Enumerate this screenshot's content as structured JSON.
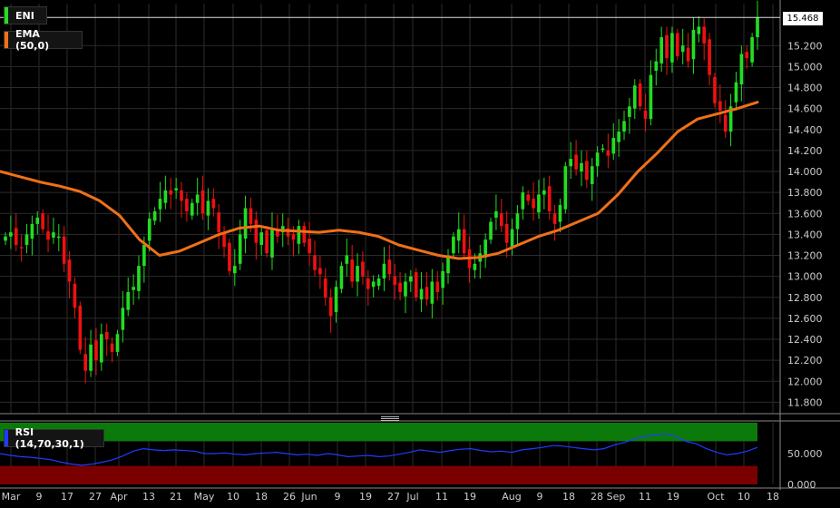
{
  "colors": {
    "background": "#000000",
    "grid": "#2b2b2b",
    "up": "#22dd22",
    "down": "#ee1111",
    "ema": "#f07018",
    "rsi_line": "#1e3cff",
    "rsi_overbought_zone": "#0b7a0b",
    "rsi_oversold_zone": "#7a0000",
    "axis_text": "#cccccc"
  },
  "legend": {
    "symbol": "ENI",
    "ema_label": "EMA (50,0)",
    "rsi_label": "RSI (14,70,30,1)"
  },
  "last_price_label": "15.468",
  "chart_data": [
    {
      "type": "candlestick",
      "title": "ENI",
      "x_tick_labels": [
        "Mar",
        "9",
        "17",
        "27",
        "Apr",
        "13",
        "21",
        "May",
        "10",
        "18",
        "26",
        "Jun",
        "9",
        "19",
        "27",
        "Jul",
        "11",
        "19",
        "Aug",
        "9",
        "18",
        "28",
        "Sep",
        "11",
        "19",
        "Oct",
        "10",
        "18"
      ],
      "y_tick_labels": [
        "15.468",
        "15.200",
        "15.000",
        "14.800",
        "14.600",
        "14.400",
        "14.200",
        "14.000",
        "13.800",
        "13.600",
        "13.400",
        "13.200",
        "13.000",
        "12.800",
        "12.600",
        "12.400",
        "12.200",
        "12.000",
        "11.800"
      ],
      "ylim": [
        11.7,
        15.6
      ],
      "grid": true,
      "series": [
        {
          "name": "ENI",
          "kind": "ohlc",
          "close": [
            13.38,
            13.42,
            13.3,
            13.28,
            13.4,
            13.5,
            13.56,
            13.45,
            13.35,
            13.42,
            13.38,
            13.12,
            12.95,
            12.7,
            12.3,
            12.1,
            12.35,
            12.2,
            12.45,
            12.4,
            12.28,
            12.45,
            12.7,
            12.85,
            12.9,
            13.1,
            13.3,
            13.55,
            13.62,
            13.74,
            13.82,
            13.78,
            13.84,
            13.72,
            13.62,
            13.7,
            13.78,
            13.6,
            13.72,
            13.65,
            13.42,
            13.28,
            13.05,
            13.1,
            13.4,
            13.65,
            13.5,
            13.32,
            13.42,
            13.22,
            13.45,
            13.38,
            13.48,
            13.38,
            13.35,
            13.48,
            13.32,
            13.22,
            13.06,
            13.02,
            12.8,
            12.62,
            12.9,
            13.1,
            13.2,
            12.95,
            13.1,
            13.0,
            12.88,
            12.95,
            12.98,
            13.12,
            13.02,
            12.92,
            12.85,
            12.95,
            13.0,
            12.8,
            12.88,
            12.78,
            12.95,
            12.85,
            13.05,
            13.2,
            13.38,
            13.45,
            13.22,
            13.08,
            13.12,
            13.22,
            13.35,
            13.52,
            13.62,
            13.48,
            13.32,
            13.45,
            13.6,
            13.8,
            13.72,
            13.65,
            13.78,
            13.82,
            13.62,
            13.5,
            13.68,
            14.05,
            14.12,
            14.02,
            14.08,
            13.92,
            14.05,
            14.18,
            14.22,
            14.15,
            14.32,
            14.38,
            14.48,
            14.62,
            14.82,
            14.62,
            14.5,
            14.92,
            15.05,
            15.28,
            15.08,
            15.32,
            15.1,
            15.2,
            15.05,
            15.35,
            15.38,
            15.22,
            14.92,
            14.65,
            14.58,
            14.38,
            14.62,
            14.85,
            15.12,
            15.08,
            15.28,
            15.468
          ]
        },
        {
          "name": "EMA (50,0)",
          "kind": "line",
          "values": [
            14.0,
            13.95,
            13.9,
            13.86,
            13.81,
            13.72,
            13.58,
            13.35,
            13.2,
            13.24,
            13.32,
            13.4,
            13.46,
            13.48,
            13.44,
            13.43,
            13.42,
            13.44,
            13.42,
            13.38,
            13.3,
            13.25,
            13.2,
            13.17,
            13.18,
            13.22,
            13.3,
            13.38,
            13.44,
            13.52,
            13.6,
            13.78,
            14.0,
            14.18,
            14.38,
            14.5,
            14.55,
            14.6,
            14.66
          ]
        }
      ]
    },
    {
      "type": "line",
      "title": "RSI (14,70,30,1)",
      "y_tick_labels": [
        "50.000",
        "0.000"
      ],
      "ylim": [
        0,
        100
      ],
      "overbought": 70,
      "oversold": 30,
      "series": [
        {
          "name": "RSI (14,70,30,1)",
          "values": [
            50,
            47,
            45,
            44,
            42,
            40,
            36,
            33,
            31,
            33,
            36,
            40,
            46,
            54,
            58,
            56,
            55,
            56,
            55,
            54,
            50,
            50,
            51,
            49,
            48,
            50,
            51,
            52,
            50,
            48,
            49,
            47,
            50,
            48,
            45,
            46,
            47,
            45,
            46,
            49,
            52,
            56,
            54,
            52,
            55,
            57,
            58,
            55,
            53,
            54,
            52,
            56,
            58,
            60,
            63,
            62,
            60,
            58,
            56,
            58,
            64,
            68,
            74,
            78,
            80,
            82,
            78,
            70,
            66,
            58,
            52,
            48,
            50,
            54,
            60
          ]
        }
      ]
    }
  ]
}
